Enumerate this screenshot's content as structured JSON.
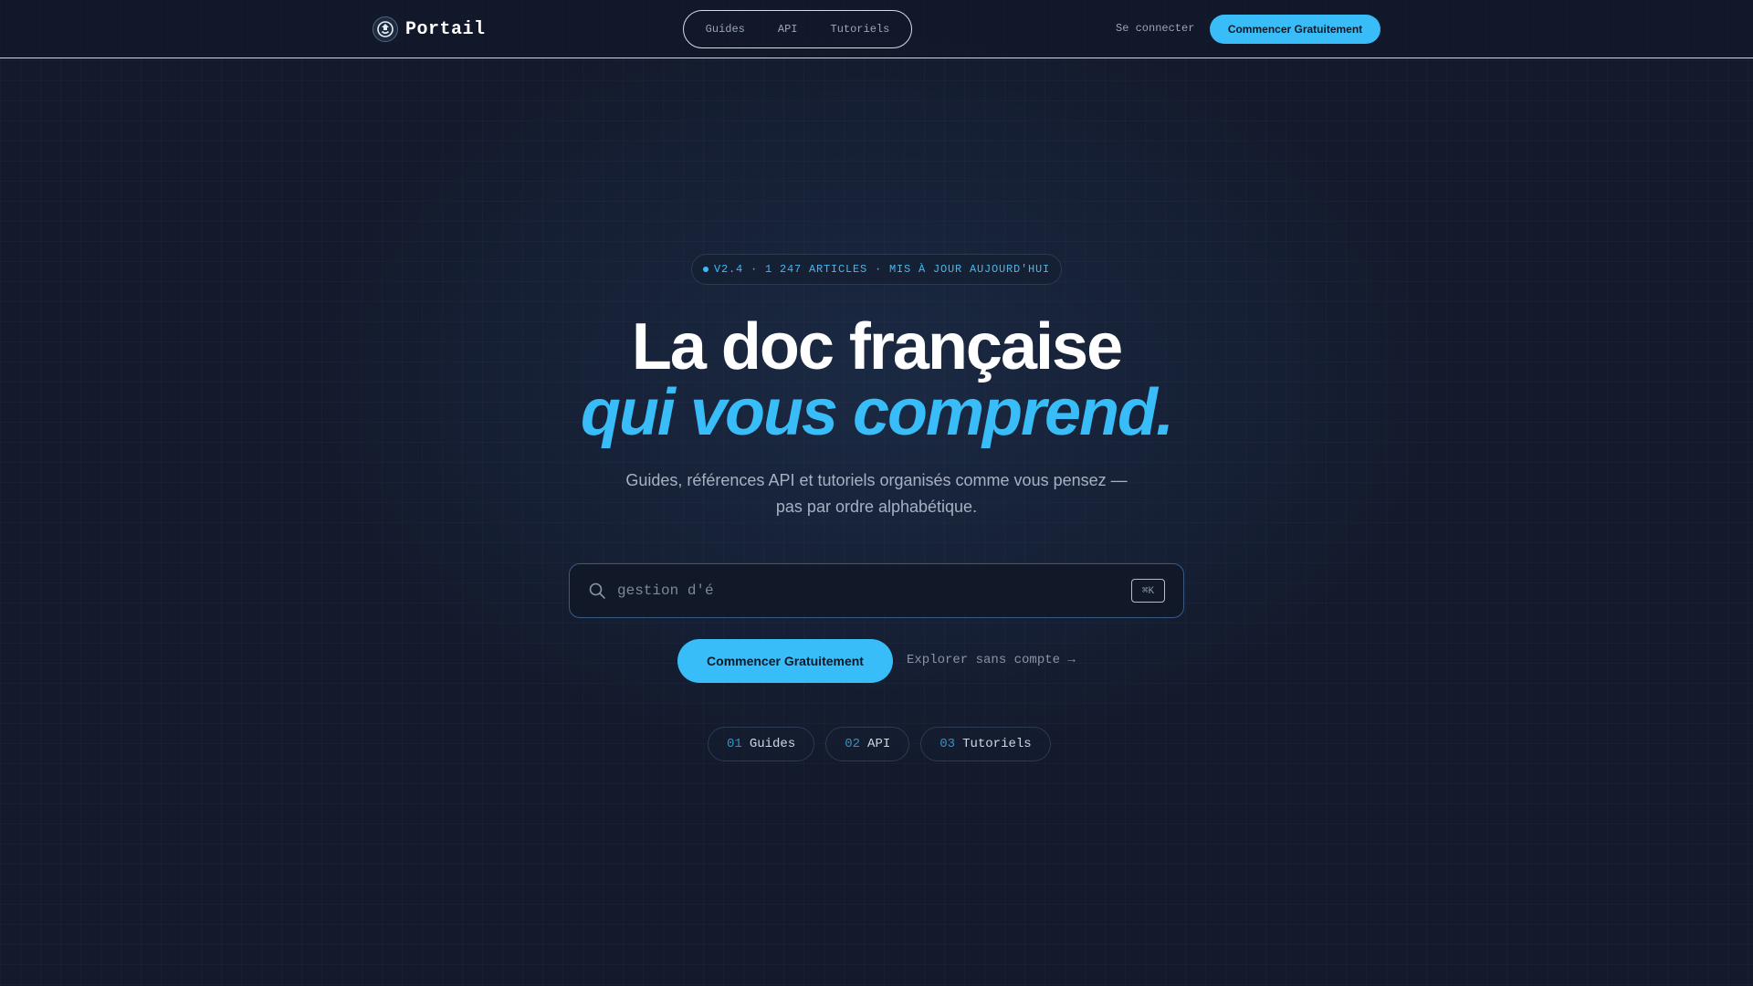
{
  "header": {
    "brand": "Portail",
    "nav": [
      "Guides",
      "API",
      "Tutoriels"
    ],
    "login_label": "Se connecter",
    "cta_label": "Commencer Gratuitement"
  },
  "hero": {
    "badge": "V2.4 · 1 247 ARTICLES · MIS À JOUR AUJOURD'HUI",
    "title_line1": "La doc française",
    "title_line2": "qui vous comprend.",
    "subtitle_line1": "Guides, références API et tutoriels organisés comme vous pensez —",
    "subtitle_line2": "pas par ordre alphabétique.",
    "search_value": "gestion d'é",
    "search_shortcut": "⌘K",
    "cta_label": "Commencer Gratuitement",
    "explore_label": "Explorer sans compte →",
    "chips": [
      {
        "num": "01",
        "label": "Guides"
      },
      {
        "num": "02",
        "label": "API"
      },
      {
        "num": "03",
        "label": "Tutoriels"
      }
    ]
  },
  "icons": {
    "brand_logo": "portal-logo-icon",
    "search": "search-icon"
  },
  "colors": {
    "background": "#131a2c",
    "accent": "#38bdf8",
    "text_primary": "#ffffff",
    "text_muted": "#a7b1c2"
  }
}
